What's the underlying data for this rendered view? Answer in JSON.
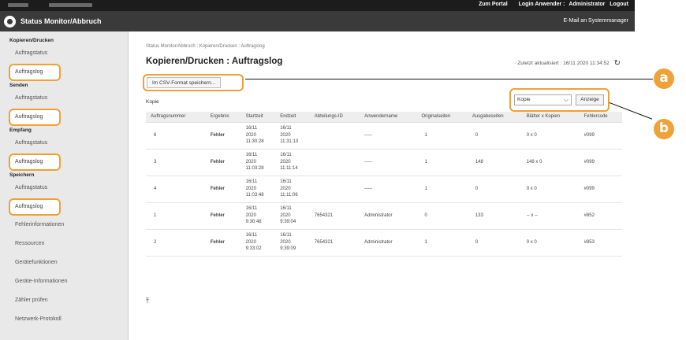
{
  "header": {
    "links": [
      "Zum Portal",
      "Login Anwender :",
      "Administrator",
      "Logout"
    ]
  },
  "titlebar": {
    "title": "Status Monitor/Abbruch",
    "email_link": "E-Mail an Systemmanager"
  },
  "sidebar": {
    "sections": [
      {
        "heading": "Kopieren/Drucken",
        "items": [
          {
            "label": "Auftragstatus",
            "active": false
          },
          {
            "label": "Auftragslog",
            "active": true
          }
        ]
      },
      {
        "heading": "Senden",
        "items": [
          {
            "label": "Auftragstatus",
            "active": false
          },
          {
            "label": "Auftragslog",
            "active": true
          }
        ]
      },
      {
        "heading": "Empfang",
        "items": [
          {
            "label": "Auftragstatus",
            "active": false
          },
          {
            "label": "Auftragslog",
            "active": true
          }
        ]
      },
      {
        "heading": "Speichern",
        "items": [
          {
            "label": "Auftragstatus",
            "active": false
          },
          {
            "label": "Auftragslog",
            "active": true
          }
        ]
      }
    ],
    "other_items": [
      "Fehlerinformationen",
      "Ressourcen",
      "Gerätefunktionen",
      "Geräte-Informationen",
      "Zähler prüfen",
      "Netzwerk-Protokoll"
    ]
  },
  "main": {
    "breadcrumb": "Status Monitor/Abbruch : Kopieren/Drucken : Auftragslog",
    "title": "Kopieren/Drucken : Auftragslog",
    "last_updated": "Zuletzt aktualisiert : 16/11 2020 11:34:52",
    "csv_button": "Im CSV-Format speichern...",
    "filter_value": "Kopie",
    "show_button": "Anzeige",
    "section_label": "Kopie",
    "columns": [
      "Auftragsnummer",
      "Ergebnis",
      "Startzeit",
      "Endzeit",
      "Abteilungs-ID",
      "Anwendername",
      "Originalseiten",
      "Ausgabeseiten",
      "Blätter x Kopien",
      "Fehlercode"
    ],
    "rows": [
      [
        "6",
        "Fehler",
        "16/11\n2020\n11:30:28",
        "16/11\n2020\n11:31:13",
        "",
        "-----",
        "1",
        "0",
        "0 x 0",
        "#099"
      ],
      [
        "3",
        "Fehler",
        "16/11\n2020\n11:03:28",
        "16/11\n2020\n11:11:14",
        "",
        "-----",
        "1",
        "148",
        "148 x 0",
        "#099"
      ],
      [
        "4",
        "Fehler",
        "16/11\n2020\n11:03:48",
        "16/11\n2020\n11:11:06",
        "",
        "-----",
        "1",
        "0",
        "0 x 0",
        "#099"
      ],
      [
        "1",
        "Fehler",
        "16/11\n2020\n9:30:48",
        "16/11\n2020\n9:39:04",
        "7654321",
        "Administrator",
        "0",
        "133",
        "-- x --",
        "#852"
      ],
      [
        "2",
        "Fehler",
        "16/11\n2020\n9:33:02",
        "16/11\n2020\n9:39:09",
        "7654321",
        "Administrator",
        "1",
        "0",
        "0 x 0",
        "#853"
      ]
    ]
  },
  "callouts": [
    "a",
    "b"
  ],
  "colors": {
    "accent": "#f1a035",
    "topbar": "#1c1c1c",
    "titlebar": "#3a3a3a"
  }
}
